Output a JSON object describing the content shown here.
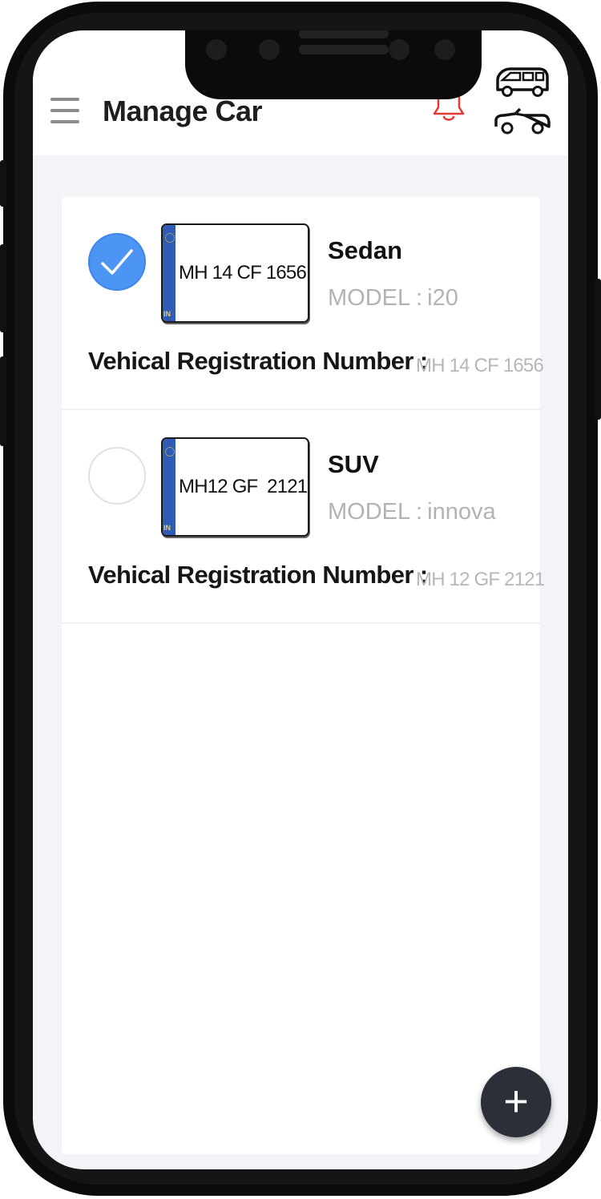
{
  "header": {
    "title": "Manage Car",
    "menu_icon": "hamburger-menu-icon",
    "notification_icon": "bell-icon",
    "cars_icon": "cars-icon",
    "notification_color": "#e53935"
  },
  "cars": [
    {
      "plate_number": "MH 14 CF 1656",
      "plate_country": "IN",
      "type": "Sedan",
      "model_label": "MODEL :",
      "model_value": "i20",
      "reg_label": "Vehical Registration Number :",
      "reg_value": "MH 14 CF 1656",
      "selected": true
    },
    {
      "plate_number": "MH12 GF  2121",
      "plate_country": "IN",
      "type": "SUV",
      "model_label": "MODEL :",
      "model_value": "innova",
      "reg_label": "Vehical Registration Number :",
      "reg_value": "MH 12 GF 2121",
      "selected": false
    }
  ],
  "fab": {
    "label": "+",
    "icon": "plus-icon"
  },
  "colors": {
    "accent": "#4c95f4",
    "fab_background": "#2b3038",
    "plate_band": "#2f5bb5"
  }
}
